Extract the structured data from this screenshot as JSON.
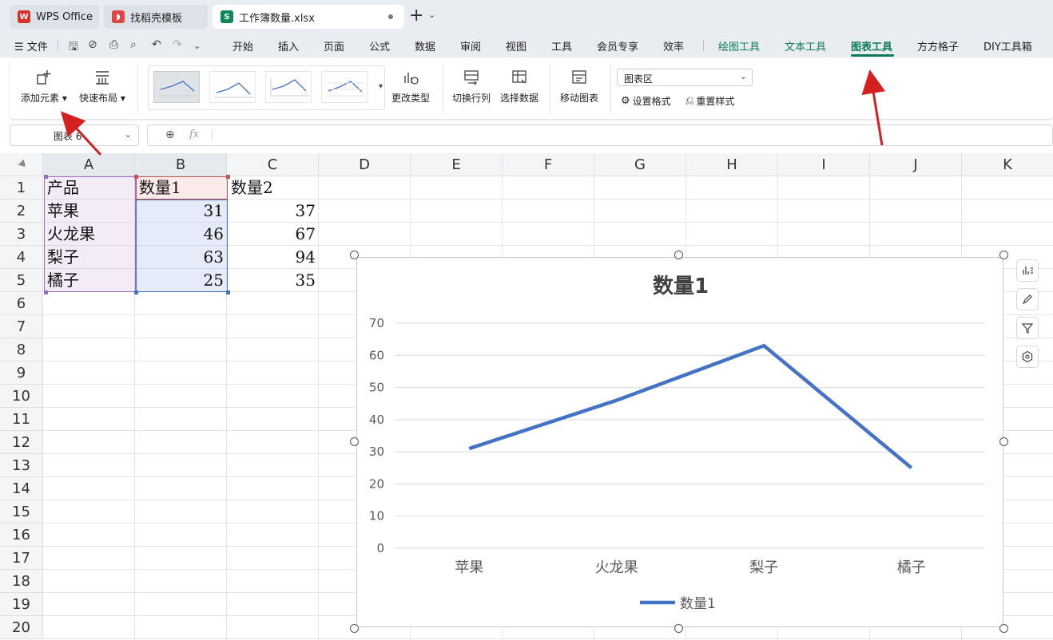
{
  "tabs": [
    {
      "label": "WPS Office",
      "icon": "wps-logo-icon",
      "color": "#d9302c"
    },
    {
      "label": "找稻壳模板",
      "icon": "docer-icon",
      "color": "#e04545"
    },
    {
      "label": "工作簿数量.xlsx",
      "icon": "spreadsheet-icon",
      "color": "#11875c"
    }
  ],
  "menubar": {
    "file": "文件",
    "items": [
      "开始",
      "插入",
      "页面",
      "公式",
      "数据",
      "审阅",
      "视图",
      "工具",
      "会员专享",
      "效率"
    ],
    "context_items": [
      "绘图工具",
      "文本工具",
      "图表工具"
    ],
    "extra_items": [
      "方方格子",
      "DIY工具箱"
    ],
    "active": "图表工具"
  },
  "ribbon": {
    "add_element": "添加元素",
    "quick_layout": "快速布局",
    "change_type": "更改类型",
    "switch_row_col": "切换行列",
    "select_data": "选择数据",
    "move_chart": "移动图表",
    "chart_area_select": "图表区",
    "set_format": "设置格式",
    "reset_style": "重置样式"
  },
  "formula_bar": {
    "name_box": "图表 6",
    "fx": "fx",
    "content": ""
  },
  "sheet": {
    "columns": [
      "A",
      "B",
      "C",
      "D",
      "E",
      "F",
      "G",
      "H",
      "I",
      "J",
      "K"
    ],
    "rows": [
      "1",
      "2",
      "3",
      "4",
      "5",
      "6",
      "7",
      "8",
      "9",
      "10",
      "11",
      "12",
      "13",
      "14",
      "15",
      "16",
      "17",
      "18",
      "19",
      "20"
    ],
    "cells": {
      "A1": "产品",
      "B1": "数量1",
      "C1": "数量2",
      "A2": "苹果",
      "B2": "31",
      "C2": "37",
      "A3": "火龙果",
      "B3": "46",
      "C3": "67",
      "A4": "梨子",
      "B4": "63",
      "C4": "94",
      "A5": "橘子",
      "B5": "25",
      "C5": "35"
    }
  },
  "chart_data": {
    "type": "line",
    "title": "数量1",
    "categories": [
      "苹果",
      "火龙果",
      "梨子",
      "橘子"
    ],
    "series": [
      {
        "name": "数量1",
        "values": [
          31,
          46,
          63,
          25
        ],
        "color": "#4472c4"
      }
    ],
    "yticks": [
      0,
      10,
      20,
      30,
      40,
      50,
      60,
      70
    ],
    "ylim": [
      0,
      70
    ],
    "grid": true,
    "legend": "bottom"
  },
  "side_tools": [
    "chart-elements-icon",
    "chart-style-icon",
    "chart-filter-icon",
    "chart-settings-icon"
  ],
  "colors": {
    "accent": "#0f7b5a",
    "arrow": "#d42020",
    "series": "#4472c4"
  }
}
